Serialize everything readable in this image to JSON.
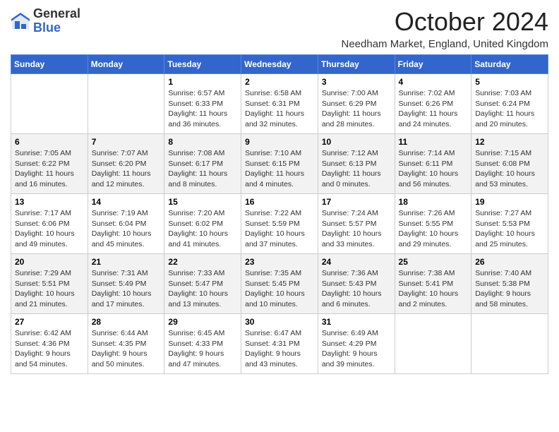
{
  "header": {
    "logo_general": "General",
    "logo_blue": "Blue",
    "month_title": "October 2024",
    "location": "Needham Market, England, United Kingdom"
  },
  "days_of_week": [
    "Sunday",
    "Monday",
    "Tuesday",
    "Wednesday",
    "Thursday",
    "Friday",
    "Saturday"
  ],
  "weeks": [
    [
      {
        "day": "",
        "info": ""
      },
      {
        "day": "",
        "info": ""
      },
      {
        "day": "1",
        "info": "Sunrise: 6:57 AM\nSunset: 6:33 PM\nDaylight: 11 hours and 36 minutes."
      },
      {
        "day": "2",
        "info": "Sunrise: 6:58 AM\nSunset: 6:31 PM\nDaylight: 11 hours and 32 minutes."
      },
      {
        "day": "3",
        "info": "Sunrise: 7:00 AM\nSunset: 6:29 PM\nDaylight: 11 hours and 28 minutes."
      },
      {
        "day": "4",
        "info": "Sunrise: 7:02 AM\nSunset: 6:26 PM\nDaylight: 11 hours and 24 minutes."
      },
      {
        "day": "5",
        "info": "Sunrise: 7:03 AM\nSunset: 6:24 PM\nDaylight: 11 hours and 20 minutes."
      }
    ],
    [
      {
        "day": "6",
        "info": "Sunrise: 7:05 AM\nSunset: 6:22 PM\nDaylight: 11 hours and 16 minutes."
      },
      {
        "day": "7",
        "info": "Sunrise: 7:07 AM\nSunset: 6:20 PM\nDaylight: 11 hours and 12 minutes."
      },
      {
        "day": "8",
        "info": "Sunrise: 7:08 AM\nSunset: 6:17 PM\nDaylight: 11 hours and 8 minutes."
      },
      {
        "day": "9",
        "info": "Sunrise: 7:10 AM\nSunset: 6:15 PM\nDaylight: 11 hours and 4 minutes."
      },
      {
        "day": "10",
        "info": "Sunrise: 7:12 AM\nSunset: 6:13 PM\nDaylight: 11 hours and 0 minutes."
      },
      {
        "day": "11",
        "info": "Sunrise: 7:14 AM\nSunset: 6:11 PM\nDaylight: 10 hours and 56 minutes."
      },
      {
        "day": "12",
        "info": "Sunrise: 7:15 AM\nSunset: 6:08 PM\nDaylight: 10 hours and 53 minutes."
      }
    ],
    [
      {
        "day": "13",
        "info": "Sunrise: 7:17 AM\nSunset: 6:06 PM\nDaylight: 10 hours and 49 minutes."
      },
      {
        "day": "14",
        "info": "Sunrise: 7:19 AM\nSunset: 6:04 PM\nDaylight: 10 hours and 45 minutes."
      },
      {
        "day": "15",
        "info": "Sunrise: 7:20 AM\nSunset: 6:02 PM\nDaylight: 10 hours and 41 minutes."
      },
      {
        "day": "16",
        "info": "Sunrise: 7:22 AM\nSunset: 5:59 PM\nDaylight: 10 hours and 37 minutes."
      },
      {
        "day": "17",
        "info": "Sunrise: 7:24 AM\nSunset: 5:57 PM\nDaylight: 10 hours and 33 minutes."
      },
      {
        "day": "18",
        "info": "Sunrise: 7:26 AM\nSunset: 5:55 PM\nDaylight: 10 hours and 29 minutes."
      },
      {
        "day": "19",
        "info": "Sunrise: 7:27 AM\nSunset: 5:53 PM\nDaylight: 10 hours and 25 minutes."
      }
    ],
    [
      {
        "day": "20",
        "info": "Sunrise: 7:29 AM\nSunset: 5:51 PM\nDaylight: 10 hours and 21 minutes."
      },
      {
        "day": "21",
        "info": "Sunrise: 7:31 AM\nSunset: 5:49 PM\nDaylight: 10 hours and 17 minutes."
      },
      {
        "day": "22",
        "info": "Sunrise: 7:33 AM\nSunset: 5:47 PM\nDaylight: 10 hours and 13 minutes."
      },
      {
        "day": "23",
        "info": "Sunrise: 7:35 AM\nSunset: 5:45 PM\nDaylight: 10 hours and 10 minutes."
      },
      {
        "day": "24",
        "info": "Sunrise: 7:36 AM\nSunset: 5:43 PM\nDaylight: 10 hours and 6 minutes."
      },
      {
        "day": "25",
        "info": "Sunrise: 7:38 AM\nSunset: 5:41 PM\nDaylight: 10 hours and 2 minutes."
      },
      {
        "day": "26",
        "info": "Sunrise: 7:40 AM\nSunset: 5:38 PM\nDaylight: 9 hours and 58 minutes."
      }
    ],
    [
      {
        "day": "27",
        "info": "Sunrise: 6:42 AM\nSunset: 4:36 PM\nDaylight: 9 hours and 54 minutes."
      },
      {
        "day": "28",
        "info": "Sunrise: 6:44 AM\nSunset: 4:35 PM\nDaylight: 9 hours and 50 minutes."
      },
      {
        "day": "29",
        "info": "Sunrise: 6:45 AM\nSunset: 4:33 PM\nDaylight: 9 hours and 47 minutes."
      },
      {
        "day": "30",
        "info": "Sunrise: 6:47 AM\nSunset: 4:31 PM\nDaylight: 9 hours and 43 minutes."
      },
      {
        "day": "31",
        "info": "Sunrise: 6:49 AM\nSunset: 4:29 PM\nDaylight: 9 hours and 39 minutes."
      },
      {
        "day": "",
        "info": ""
      },
      {
        "day": "",
        "info": ""
      }
    ]
  ]
}
